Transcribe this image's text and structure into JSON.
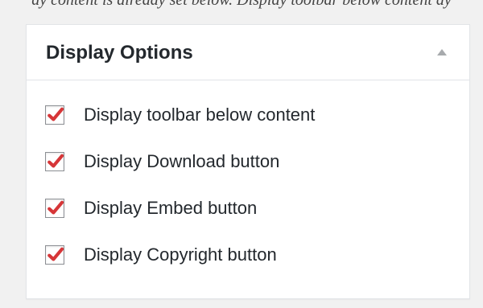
{
  "top_caption": "ay content is already set below. Display toolbar below content ay",
  "panel": {
    "title": "Display Options",
    "toggle_icon": "triangle-up-icon"
  },
  "options": [
    {
      "label": "Display toolbar below content",
      "checked": true
    },
    {
      "label": "Display Download button",
      "checked": true
    },
    {
      "label": "Display Embed button",
      "checked": true
    },
    {
      "label": "Display Copyright button",
      "checked": true
    }
  ],
  "colors": {
    "background": "#f1f1f1",
    "panel": "#ffffff",
    "border": "#e2e4e7",
    "text": "#23282d",
    "check": "#d63638",
    "toggle": "#a7aaad"
  }
}
